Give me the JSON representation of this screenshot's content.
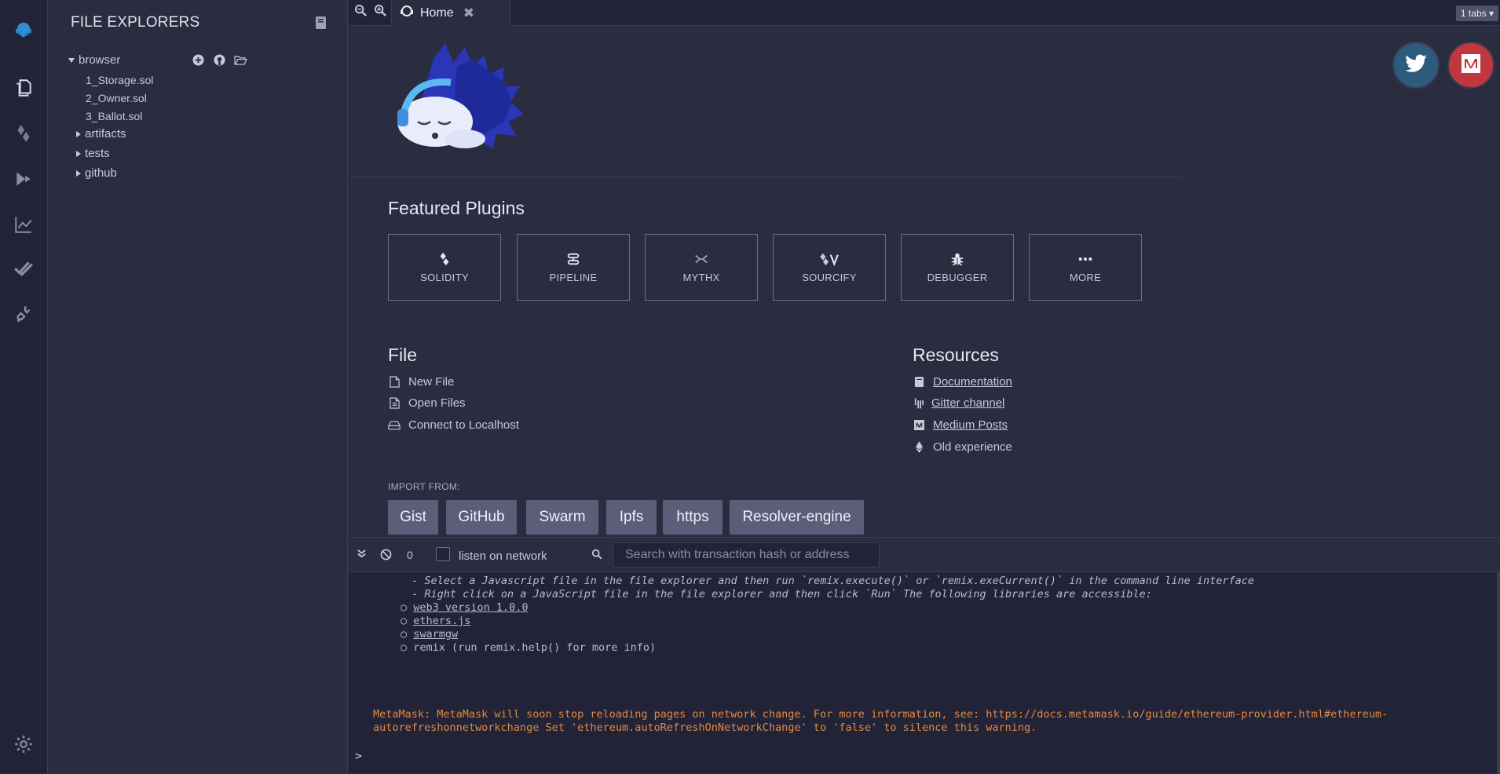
{
  "explorer": {
    "title": "FILE EXPLORERS",
    "root": "browser",
    "files": [
      "1_Storage.sol",
      "2_Owner.sol",
      "3_Ballot.sol"
    ],
    "folders": [
      "artifacts",
      "tests",
      "github"
    ]
  },
  "tabs": {
    "home_label": "Home",
    "count_label": "1 tabs"
  },
  "featured": {
    "title": "Featured Plugins",
    "plugins": [
      "SOLIDITY",
      "PIPELINE",
      "MYTHX",
      "SOURCIFY",
      "DEBUGGER",
      "MORE"
    ]
  },
  "file_section": {
    "title": "File",
    "items": [
      "New File",
      "Open Files",
      "Connect to Localhost"
    ],
    "import_label": "IMPORT FROM:",
    "import_buttons": [
      "Gist",
      "GitHub",
      "Swarm",
      "Ipfs",
      "https",
      "Resolver-engine"
    ]
  },
  "resources": {
    "title": "Resources",
    "items": [
      "Documentation",
      "Gitter channel",
      "Medium Posts",
      "Old experience"
    ]
  },
  "terminal": {
    "count": "0",
    "listen_label": "listen on network",
    "search_placeholder": "Search with transaction hash or address",
    "lines": [
      " - Select a Javascript file in the file explorer and then run `remix.execute()` or `remix.exeCurrent()` in the command line interface",
      " - Right click on a JavaScript file in the file explorer and then click `Run` The following libraries are accessible:"
    ],
    "libs": [
      "web3 version 1.0.0",
      "ethers.js",
      "swarmgw",
      "remix (run remix.help() for more info)"
    ],
    "warning_1": "MetaMask: MetaMask will soon stop reloading pages on network change. For more information, see: https://docs.metamask.io/guide/ethereum-provider.html#ethereum-",
    "warning_2": "autorefreshonnetworkchange Set 'ethereum.autoRefreshOnNetworkChange' to 'false' to silence this warning.",
    "prompt": ">"
  },
  "colors": {
    "background": "#2a2c3f",
    "rail": "#222336",
    "import_button": "#5b5e79",
    "warning": "#e08a45",
    "twitter": "#2d5b7e",
    "medium": "#c0383e"
  },
  "icons": {
    "rail": [
      "remix-logo-icon",
      "file-explorer-icon",
      "solidity-compiler-icon",
      "deploy-run-icon",
      "analysis-icon",
      "tests-check-icon",
      "plugin-manager-icon",
      "settings-gear-icon"
    ]
  }
}
